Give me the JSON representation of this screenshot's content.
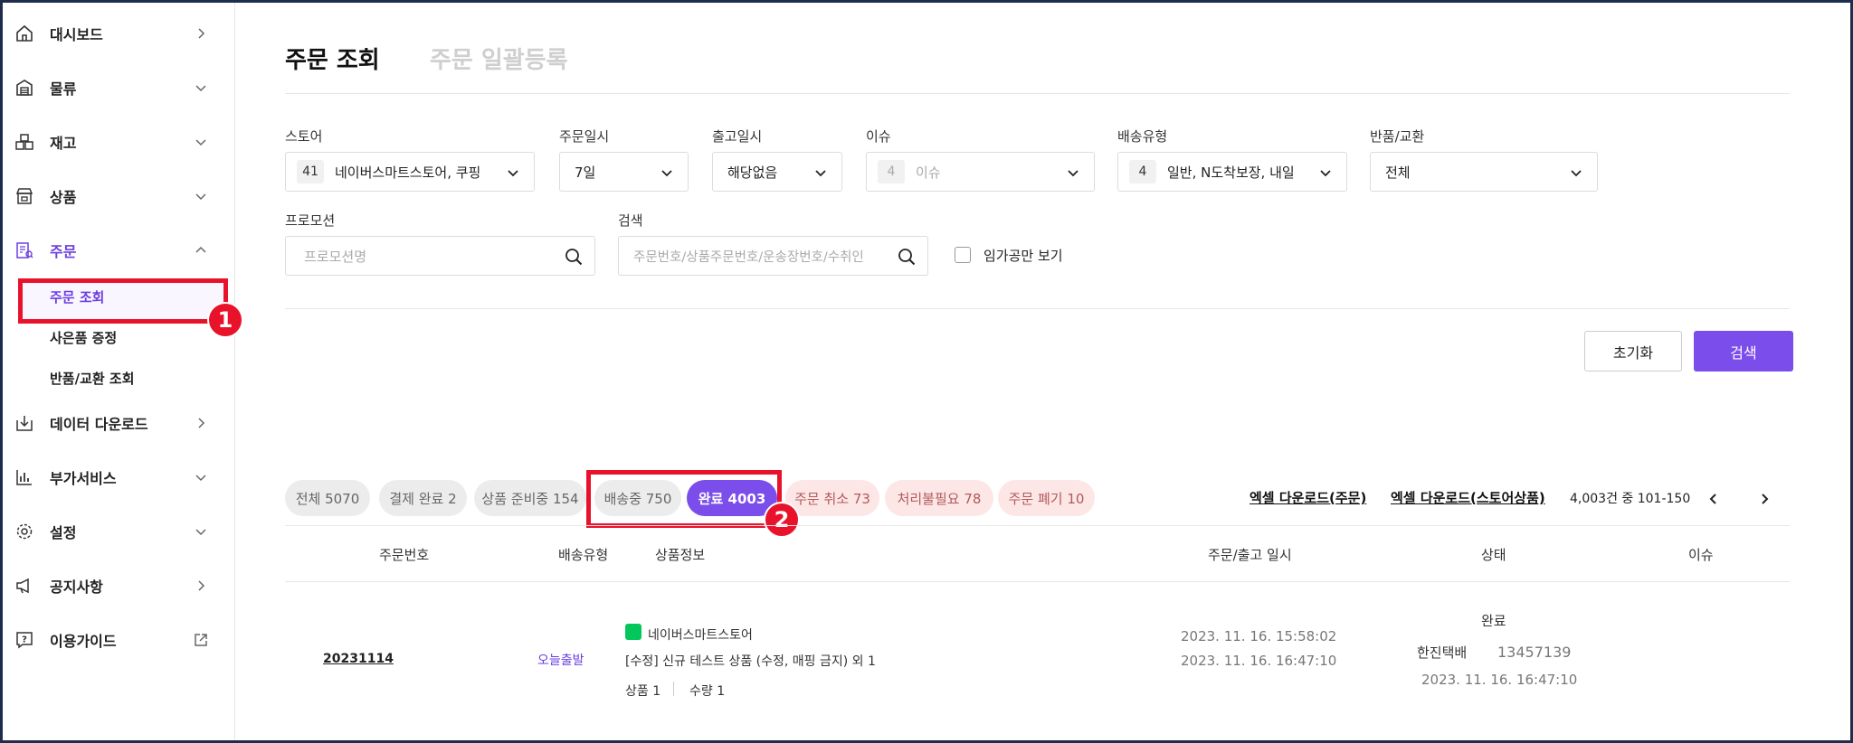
{
  "sidebar": {
    "items": [
      {
        "label": "대시보드",
        "icon": "home-icon",
        "chevron": "right"
      },
      {
        "label": "물류",
        "icon": "warehouse-icon",
        "chevron": "down"
      },
      {
        "label": "재고",
        "icon": "boxes-icon",
        "chevron": "down"
      },
      {
        "label": "상품",
        "icon": "store-icon",
        "chevron": "down"
      },
      {
        "label": "주문",
        "icon": "order-icon",
        "chevron": "up"
      },
      {
        "label": "데이터 다운로드",
        "icon": "download-icon",
        "chevron": "right"
      },
      {
        "label": "부가서비스",
        "icon": "chart-icon",
        "chevron": "down"
      },
      {
        "label": "설정",
        "icon": "gear-icon",
        "chevron": "down"
      },
      {
        "label": "공지사항",
        "icon": "megaphone-icon",
        "chevron": "right"
      },
      {
        "label": "이용가이드",
        "icon": "help-icon",
        "chevron": "external"
      }
    ],
    "sub_items": [
      "주문 조회",
      "사은품 증정",
      "반품/교환 조회"
    ]
  },
  "annotations": {
    "badge1": "1",
    "badge2": "2"
  },
  "tabs": {
    "active": "주문 조회",
    "inactive": "주문 일괄등록"
  },
  "filters": {
    "store": {
      "label": "스토어",
      "count": "41",
      "value": "네이버스마트스토어, 쿠핑"
    },
    "order_date": {
      "label": "주문일시",
      "value": "7일"
    },
    "ship_date": {
      "label": "출고일시",
      "value": "해당없음"
    },
    "issue": {
      "label": "이슈",
      "count": "4",
      "value": "이슈"
    },
    "delivery_type": {
      "label": "배송유형",
      "count": "4",
      "value": "일반, N도착보장, 내일"
    },
    "return": {
      "label": "반품/교환",
      "value": "전체"
    },
    "promotion": {
      "label": "프로모션",
      "placeholder": "프로모션명"
    },
    "search": {
      "label": "검색",
      "placeholder": "주문번호/상품주문번호/운송장번호/수취인"
    },
    "checkbox_label": "임가공만 보기"
  },
  "buttons": {
    "reset": "초기화",
    "search": "검색"
  },
  "status_chips": [
    {
      "label": "전체 5070",
      "style": "gray"
    },
    {
      "label": "결제 완료 2",
      "style": "gray"
    },
    {
      "label": "상품 준비중 154",
      "style": "gray"
    },
    {
      "label": "배송중 750",
      "style": "gray"
    },
    {
      "label": "완료 4003",
      "style": "purple"
    },
    {
      "label": "주문 취소 73",
      "style": "pink"
    },
    {
      "label": "처리불필요 78",
      "style": "pink"
    },
    {
      "label": "주문 폐기 10",
      "style": "pink"
    }
  ],
  "downloads": {
    "orders": "엑셀 다운로드(주문)",
    "store_products": "엑셀 다운로드(스토어상품)"
  },
  "pagination": {
    "info": "4,003건 중 101-150"
  },
  "table": {
    "headers": [
      "주문번호",
      "배송유형",
      "상품정보",
      "주문/출고 일시",
      "상태",
      "이슈"
    ],
    "row": {
      "order_no": "20231114",
      "delivery_type": "오늘출발",
      "store": "네이버스마트스토어",
      "product": "[수정] 신규 테스트 상품 (수정, 매핑 금지) 외 1",
      "product_count": "상품 1",
      "quantity": "수량 1",
      "order_datetime": "2023. 11. 16. 15:58:02",
      "ship_datetime": "2023. 11. 16. 16:47:10",
      "status": "완료",
      "courier": "한진택배",
      "tracking_no": "13457139",
      "status_datetime": "2023. 11. 16. 16:47:10"
    }
  },
  "colors": {
    "accent": "#7b4dea",
    "highlight": "#e8132b",
    "frame": "#1f2d4d"
  }
}
